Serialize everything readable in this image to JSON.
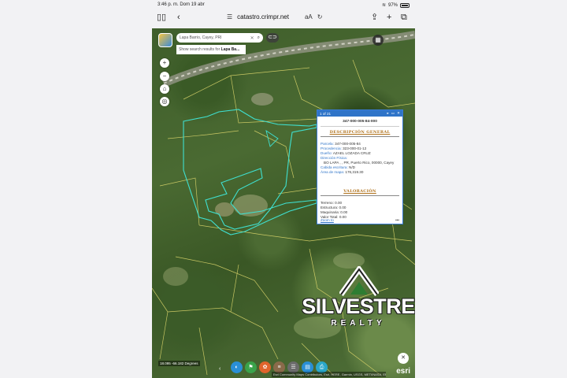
{
  "statusbar": {
    "time_date": "3:46 p. m.  Dom 19 abr",
    "battery": "97%"
  },
  "browser": {
    "url": "catastro.crimpr.net",
    "reader_icon": "aA",
    "share_icon": "share-icon",
    "new_tab_icon": "+",
    "tabs_icon": "tabs-icon"
  },
  "map": {
    "search": {
      "value": "Lapa Barrio, Cayey, PRI",
      "hint_prefix": "Show search results for ",
      "hint_term": "Lapa Ba..."
    },
    "coordinates": "18.095 -66.182 Degrees",
    "attribution": "Esri Community Maps Contributors, Esri, HERE, Garmin, USGS, METI/NASA, EPA, USDA | Junta de Pla...",
    "esri": "esri",
    "controls": [
      "+",
      "−",
      "⌂",
      "◎"
    ]
  },
  "popup": {
    "pager": "1 of 21",
    "parcel_id": "347-000-005-84-000",
    "section_general": "DESCRIPCIÓN GENERAL",
    "general": [
      {
        "k": "Parcela:",
        "v": "347-000-005-84"
      },
      {
        "k": "Procedencia:",
        "v": "323-000-01-12"
      },
      {
        "k": "Dueño:",
        "v": "AZAEL LOZADA CRUZ"
      },
      {
        "k": "Dirección Física:",
        "v": ""
      }
    ],
    "address": "BO LAPA , , PR, Puerto Rico, 00000, Cayey",
    "cabida": {
      "k": "Cabida escritura:",
      "v": "N/D"
    },
    "area": {
      "k": "Área de mapa:",
      "v": "176,319.30"
    },
    "section_valuation": "VALORACIÓN",
    "valuation": [
      {
        "k": "Terreno:",
        "v": "0.00"
      },
      {
        "k": "Estructura:",
        "v": "0.00"
      },
      {
        "k": "Maquinaria:",
        "v": "0.00"
      },
      {
        "k": "Valor Total:",
        "v": "0.00"
      },
      {
        "k": "Exención:",
        "v": "0.00"
      }
    ],
    "zoom_to": "Zoom to",
    "more": "•••"
  },
  "brand": {
    "name": "SILVESTRE",
    "sub": "REALTY"
  },
  "colors": {
    "parcel_highlight": "#3fe0d0",
    "parcel_lines": "#d8d36a",
    "popup_header": "#2f74c8",
    "section_title": "#b0721c"
  }
}
